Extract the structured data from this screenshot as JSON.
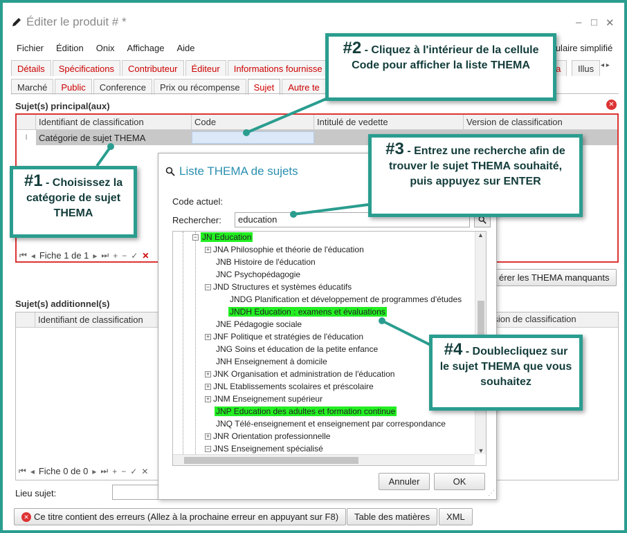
{
  "window": {
    "title": "Éditer le produit #  *",
    "minimize": "–",
    "restore": "□",
    "close": "✕"
  },
  "menu": [
    "Fichier",
    "Édition",
    "Onix",
    "Affichage",
    "Aide"
  ],
  "simplified_form": "mulaire simplifié",
  "tabs_row1": [
    "Détails",
    "Spécifications",
    "Contributeur",
    "Éditeur",
    "Informations fournisse",
    "dia",
    "Illus"
  ],
  "tabs_row2": [
    "Marché",
    "Public",
    "Conference",
    "Prix ou récompense",
    "Sujet",
    "Autre te"
  ],
  "main_subjects": {
    "label": "Sujet(s) principal(aux)",
    "columns": [
      "Identifiant de classification",
      "Code",
      "Intitulé de vedette",
      "Version de classification"
    ],
    "row": {
      "indicator": "I",
      "identifier": "Catégorie de sujet THEMA",
      "code": ""
    },
    "nav": "Fiche 1 de 1",
    "missing_btn": "érer les THEMA manquants"
  },
  "additional_subjects": {
    "label": "Sujet(s) additionnel(s)",
    "columns": [
      "Identifiant de classification",
      "rsion de classification"
    ],
    "nav": "Fiche 0 de 0"
  },
  "lieu_sujet": "Lieu sujet:",
  "footer": {
    "errors_btn": "Ce titre contient des erreurs (Allez à la prochaine erreur en appuyant sur F8)",
    "toc_btn": "Table des matières",
    "xml_btn": "XML"
  },
  "dialog": {
    "title": "Liste THEMA de sujets",
    "current_code_label": "Code actuel:",
    "search_label": "Rechercher:",
    "search_value": "education",
    "cancel": "Annuler",
    "ok": "OK",
    "tree": [
      {
        "text": "JN Education",
        "highlight": true
      },
      {
        "text": "JNA Philosophie et théorie de l'éducation",
        "highlight": false
      },
      {
        "text": "JNB Histoire de l'éducation",
        "highlight": false
      },
      {
        "text": "JNC Psychopédagogie",
        "highlight": false
      },
      {
        "text": "JND Structures et systèmes éducatifs",
        "highlight": false
      },
      {
        "text": "JNDG Planification et développement de programmes d'études",
        "highlight": false
      },
      {
        "text": "JNDH Education : examens et évaluations",
        "highlight": true
      },
      {
        "text": "JNE Pédagogie sociale",
        "highlight": false
      },
      {
        "text": "JNF Politique et stratégies de l'éducation",
        "highlight": false
      },
      {
        "text": "JNG Soins et éducation de la petite enfance",
        "highlight": false
      },
      {
        "text": "JNH Enseignement à domicile",
        "highlight": false
      },
      {
        "text": "JNK Organisation et administration de l'éducation",
        "highlight": false
      },
      {
        "text": "JNL Etablissements scolaires et préscolaire",
        "highlight": false
      },
      {
        "text": "JNM Enseignement supérieur",
        "highlight": false
      },
      {
        "text": "JNP Education des adultes et formation continue",
        "highlight": true
      },
      {
        "text": "JNQ Télé-enseignement et enseignement par correspondance",
        "highlight": false
      },
      {
        "text": "JNR Orientation professionnelle",
        "highlight": false
      },
      {
        "text": "JNS Enseignement spécialisé",
        "highlight": false
      }
    ]
  },
  "callouts": {
    "c1": {
      "num": "#1",
      "text": "- Choisissez la catégorie de sujet THEMA"
    },
    "c2": {
      "num": "#2",
      "text": "- Cliquez à l'intérieur de la cellule Code pour afficher la liste THEMA"
    },
    "c3": {
      "num": "#3",
      "text": "- Entrez une recherche afin de trouver le sujet THEMA souhaité, puis appuyez sur ENTER"
    },
    "c4": {
      "num": "#4",
      "text": "- Doublecliquez sur le sujet THEMA que vous souhaitez"
    }
  },
  "colors": {
    "accent": "#2a9d8f",
    "error": "#dd3333",
    "highlight": "#22ee22",
    "link": "#2a8fb0"
  }
}
